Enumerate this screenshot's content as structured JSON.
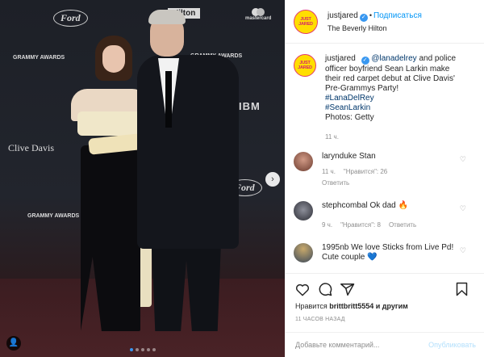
{
  "photo": {
    "backdrop_logos": {
      "ford": "Ford",
      "hilton": "Hilton",
      "mastercard": "mastercard",
      "grammy": "GRAMMY AWARDS",
      "clive": "Clive Davis",
      "ibm": "IBM"
    },
    "carousel_dots": 5,
    "active_dot": 1
  },
  "header": {
    "avatar_text": "JUST JARED",
    "username": "justjared",
    "follow_label": "Подписаться",
    "location": "The Beverly Hilton"
  },
  "caption": {
    "username": "justjared",
    "mention": "@lanadelrey",
    "text": " and police officer boyfriend Sean Larkin make their red carpet debut at Clive Davis' Pre-Grammys Party!",
    "hashtag1": "#LanaDelRey",
    "hashtag2": "#SeanLarkin",
    "credit": "Photos: Getty",
    "time": "11 ч."
  },
  "comments": [
    {
      "username": "larynduke",
      "text": "Stan",
      "time": "11 ч.",
      "likes": "\"Нравится\": 26",
      "reply": "Ответить"
    },
    {
      "username": "stephcombal",
      "text": "Ok dad 🔥",
      "time": "9 ч.",
      "likes": "\"Нравится\": 8",
      "reply": "Ответить"
    },
    {
      "username": "1995nb",
      "text": "We love Sticks from Live Pd! Cute couple 💙",
      "time": "",
      "likes": "",
      "reply": ""
    }
  ],
  "actions": {
    "likes_prefix": "Нравится ",
    "likes_user": "brittbritt5554",
    "likes_suffix": " и другим",
    "time_ago": "11 ЧАСОВ НАЗАД"
  },
  "add_comment": {
    "placeholder": "Добавьте комментарий...",
    "publish_label": "Опубликовать"
  },
  "colors": {
    "accent": "#0095f6",
    "verified": "#3897f0",
    "publish_disabled": "#b2dffc"
  }
}
